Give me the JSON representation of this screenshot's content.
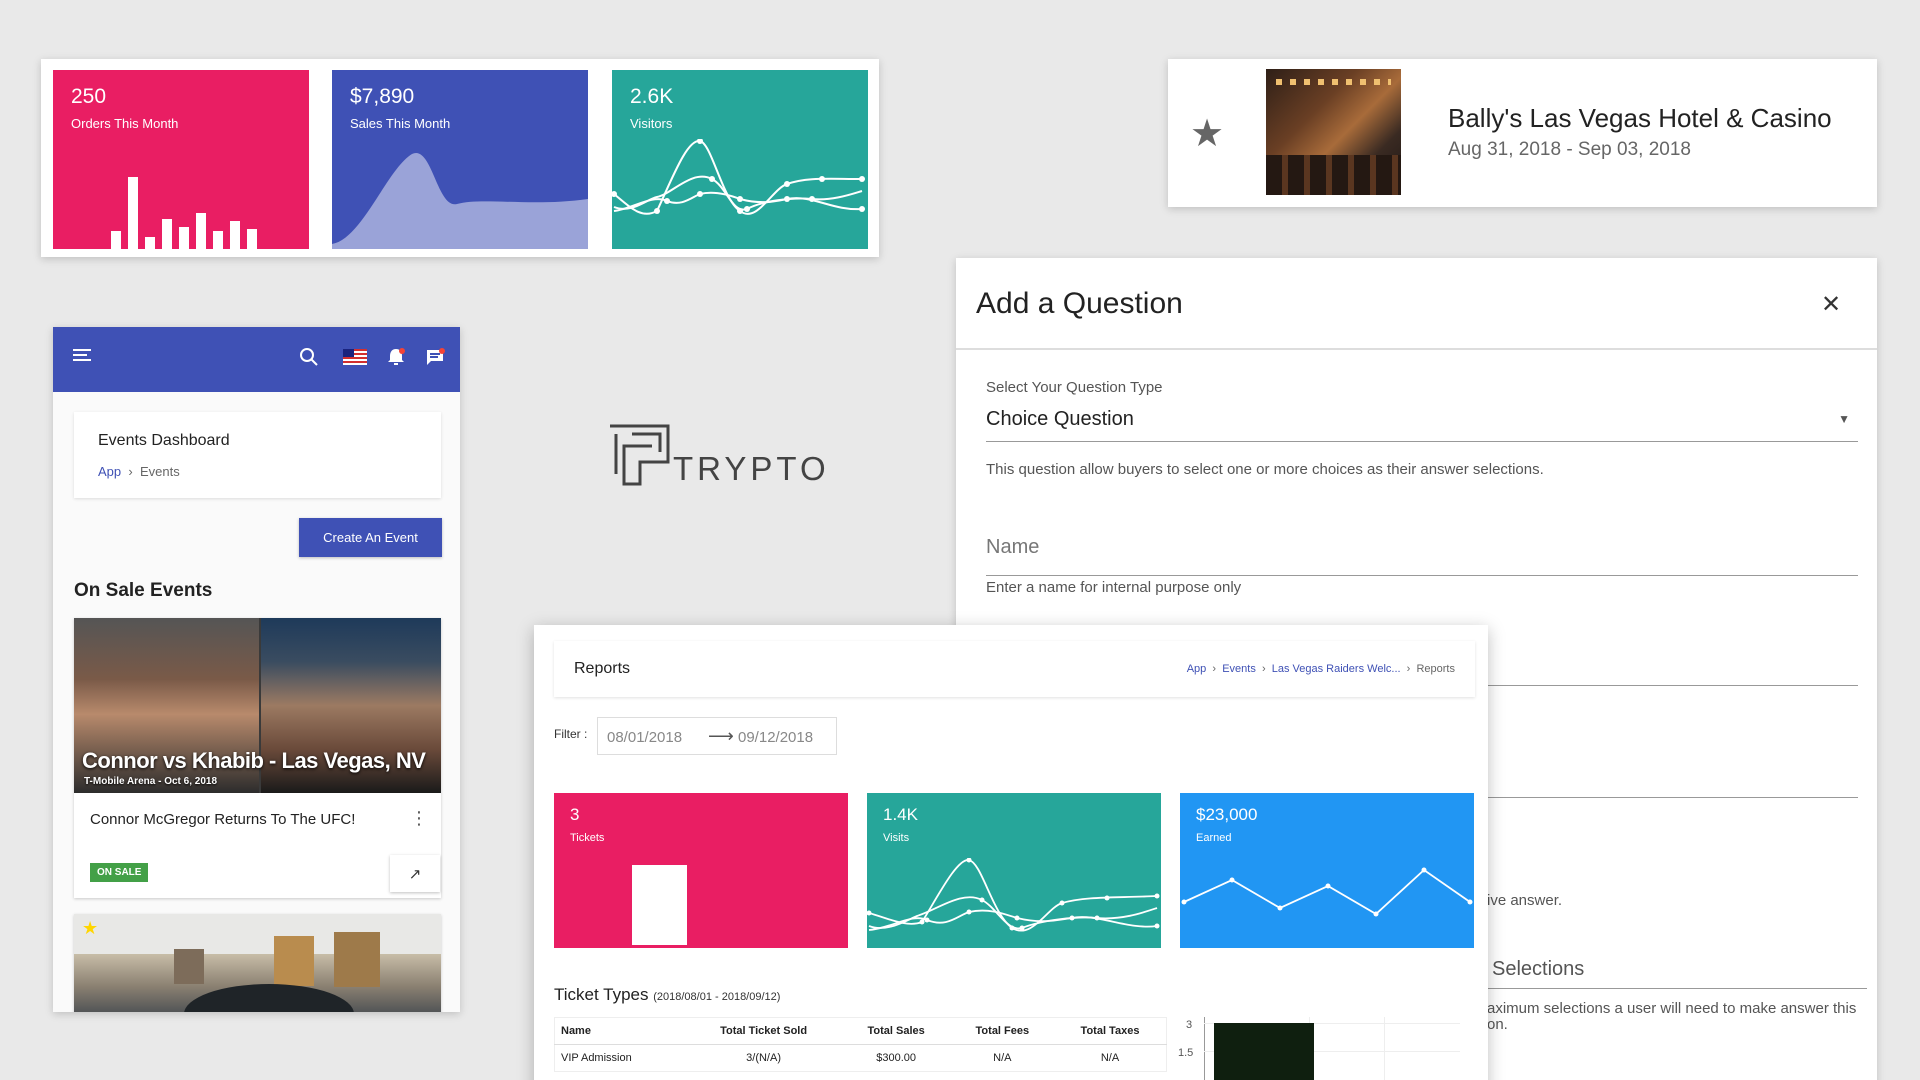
{
  "stats": {
    "orders": {
      "value": "250",
      "label": "Orders This Month",
      "color": "#e91e63",
      "bars": [
        0.18,
        0.72,
        0.12,
        0.3,
        0.22,
        0.36,
        0.18,
        0.28,
        0.2
      ]
    },
    "sales": {
      "value": "$7,890",
      "label": "Sales This Month",
      "color": "#3f51b5"
    },
    "visitors": {
      "value": "2.6K",
      "label": "Visitors",
      "color": "#26a69a"
    }
  },
  "hotel": {
    "name": "Bally's Las Vegas Hotel & Casino",
    "dates": "Aug 31, 2018 - Sep 03, 2018",
    "star_icon": "star-icon"
  },
  "mobile": {
    "topbar_color": "#3f51b5",
    "icons": [
      "menu-icon",
      "search-icon",
      "us-flag-icon",
      "notification-bell-icon",
      "chat-icon"
    ],
    "page_title": "Events Dashboard",
    "breadcrumb": {
      "root": "App",
      "current": "Events"
    },
    "create_button": "Create An Event",
    "section_title": "On Sale Events",
    "event": {
      "image_caption": "Connor vs Khabib - Las Vegas, NV",
      "image_subcaption": "T-Mobile Arena - Oct 6, 2018",
      "title": "Connor McGregor Returns To The UFC!",
      "badge": "ON SALE"
    }
  },
  "logo": {
    "text": "TRYPTO"
  },
  "question_modal": {
    "title": "Add a Question",
    "type_label": "Select Your Question Type",
    "type_value": "Choice Question",
    "type_help": "This question allow buyers to select one or more choices as their answer selections.",
    "name_placeholder": "Name",
    "name_help": "Enter a name for internal purpose only",
    "partial_help": "ive answer.",
    "selections_label": "Selections",
    "selections_help_1": "aximum selections a user will need to make answer this",
    "selections_help_2": "on."
  },
  "reports": {
    "title": "Reports",
    "breadcrumb": [
      "App",
      "Events",
      "Las Vegas Raiders Welc...",
      "Reports"
    ],
    "filter_label": "Filter :",
    "date_from": "08/01/2018",
    "date_to": "09/12/2018",
    "tiles": [
      {
        "value": "3",
        "label": "Tickets",
        "color": "#e91e63"
      },
      {
        "value": "1.4K",
        "label": "Visits",
        "color": "#26a69a"
      },
      {
        "value": "$23,000",
        "label": "Earned",
        "color": "#2196f3"
      }
    ],
    "ticket_types_title": "Ticket Types",
    "ticket_types_range": "(2018/08/01 - 2018/09/12)",
    "table": {
      "headers": [
        "Name",
        "Total Ticket Sold",
        "Total Sales",
        "Total Fees",
        "Total Taxes"
      ],
      "rows": [
        [
          "VIP Admission",
          "3/(N/A)",
          "$300.00",
          "N/A",
          "N/A"
        ]
      ]
    },
    "mini_chart": {
      "y_ticks": [
        "3",
        "1.5"
      ]
    }
  }
}
